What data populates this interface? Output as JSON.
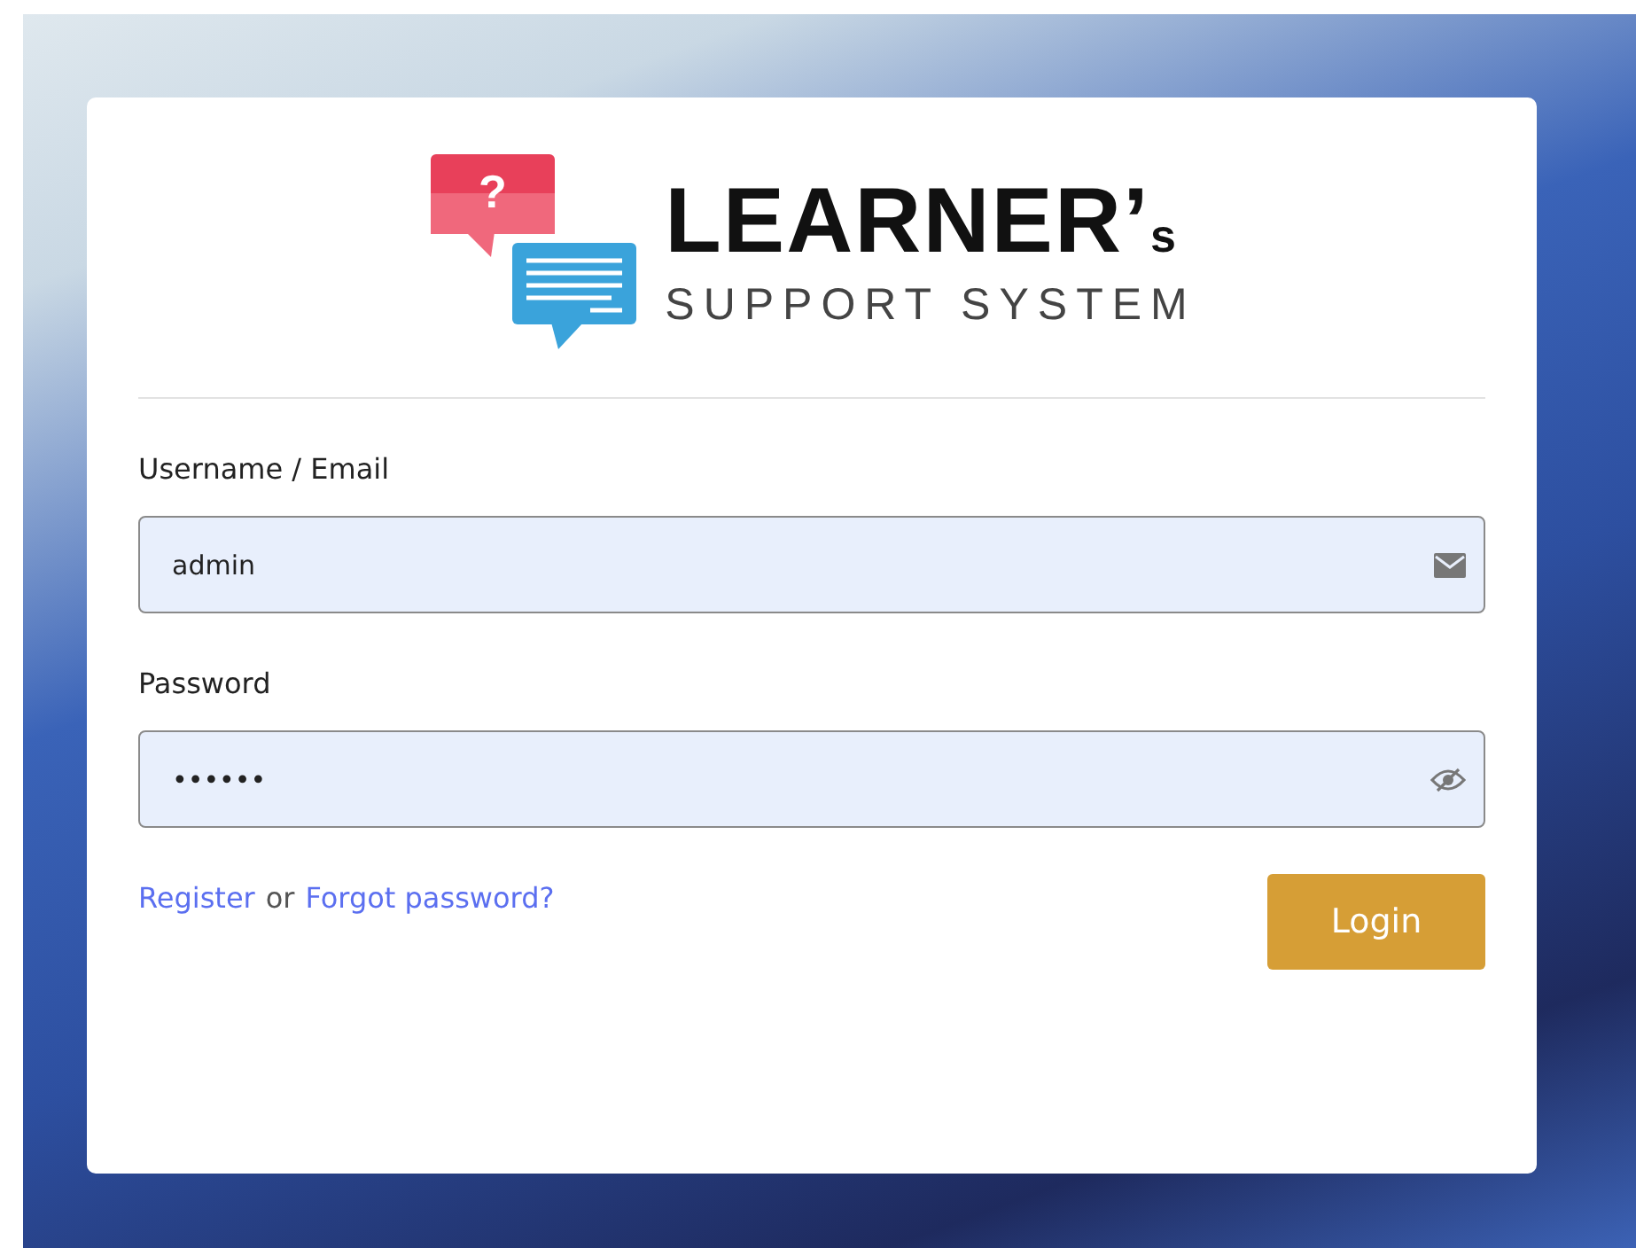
{
  "logo": {
    "mark": "?",
    "title": "LEARNER’$_{s}$",
    "subtitle": "SUPPORT SYSTEM"
  },
  "form": {
    "fields": [
      {
        "label": "Username / Email",
        "value": "admin",
        "kind": "email"
      },
      {
        "label": "Password",
        "value": "••••••",
        "kind": "password"
      }
    ],
    "links": {
      "register": "Register",
      "separator": "or",
      "forgot": "Forgot password?"
    },
    "submit": "Login"
  }
}
